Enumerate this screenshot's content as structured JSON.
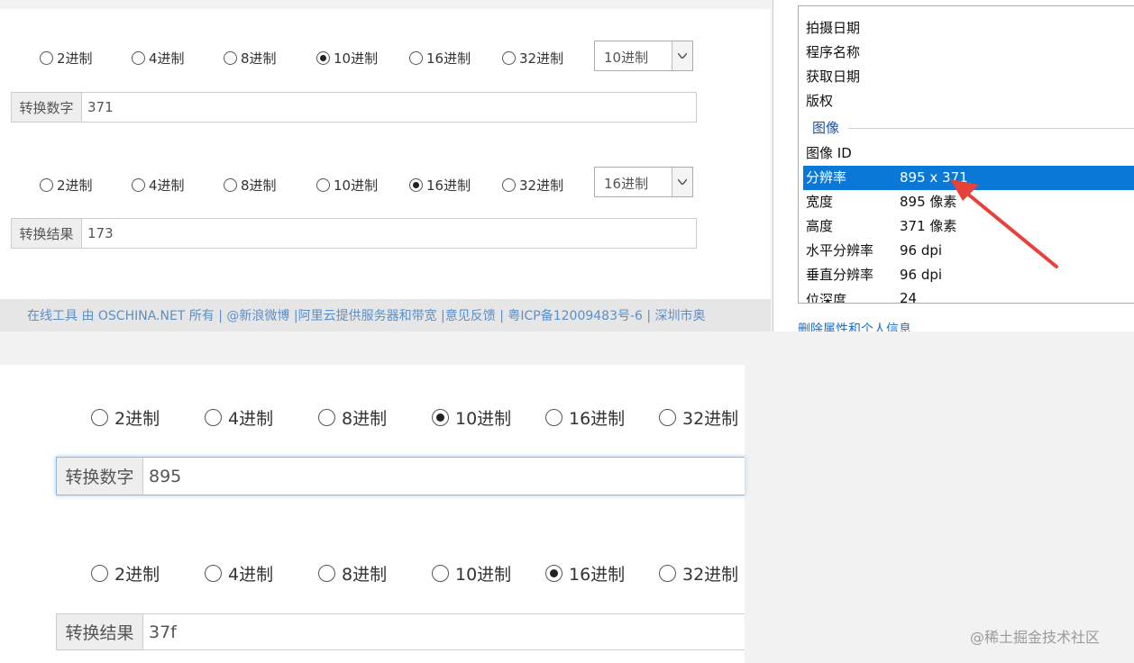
{
  "top_converter": {
    "radios": [
      "2进制",
      "4进制",
      "8进制",
      "10进制",
      "16进制",
      "32进制"
    ],
    "input_selected": "10进制",
    "input_select": "10进制",
    "input_label": "转换数字",
    "input_value": "371",
    "output_selected": "16进制",
    "output_select": "16进制",
    "output_label": "转换结果",
    "output_value": "173"
  },
  "footer_strip": {
    "text": "在线工具 由 OSCHINA.NET 所有 | @新浪微博 |阿里云提供服务器和带宽 |意见反馈 | 粤ICP备12009483号-6 | 深圳市奥"
  },
  "properties": {
    "rows_top": [
      "拍摄日期",
      "程序名称",
      "获取日期",
      "版权"
    ],
    "section": "图像",
    "image_id": "图像 ID",
    "resolution_label": "分辨率",
    "resolution_value": "895 x 371",
    "width_label": "宽度",
    "width_value": "895 像素",
    "height_label": "高度",
    "height_value": "371 像素",
    "hres_label": "水平分辨率",
    "hres_value": "96 dpi",
    "vres_label": "垂直分辨率",
    "vres_value": "96 dpi",
    "depth_label": "位深度",
    "depth_value": "24",
    "remove_link": "删除属性和个人信息"
  },
  "bottom_converter": {
    "radios": [
      "2进制",
      "4进制",
      "8进制",
      "10进制",
      "16进制",
      "32进制"
    ],
    "input_selected": "10进制",
    "input_label": "转换数字",
    "input_value": "895",
    "output_selected": "16进制",
    "output_label": "转换结果",
    "output_value": "37f"
  },
  "watermark": "@稀土掘金技术社区",
  "colors": {
    "selection": "#0a78d7",
    "arrow": "#e8413c",
    "link": "#1a6fc9"
  }
}
